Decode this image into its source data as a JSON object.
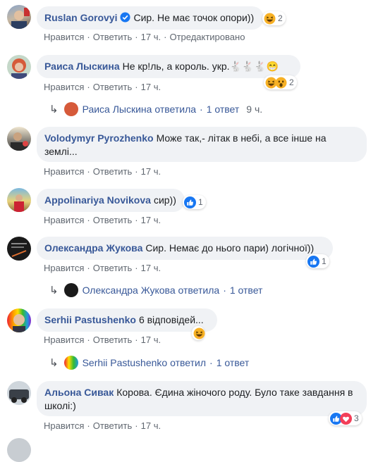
{
  "colors": {
    "link": "#385898",
    "bubble": "#f0f2f5",
    "meta": "#606770",
    "like": "#1877f2",
    "haha": "#f7b125",
    "love": "#f33e58"
  },
  "comments": [
    {
      "author": "Ruslan Gorovyi",
      "verified": true,
      "text": "Сир. Не має точок опори))",
      "actions": [
        "Нравится",
        "Ответить"
      ],
      "time": "17 ч.",
      "edited": "Отредактировано",
      "reactions": [
        "haha-emoji"
      ],
      "reaction_count": "2"
    },
    {
      "author": "Раиса Лыскина",
      "text": "Не кр!ль, а король. укр.🐇🐇🐇😁",
      "actions": [
        "Нравится",
        "Ответить"
      ],
      "time": "17 ч.",
      "reactions": [
        "haha-emoji",
        "wow-emoji"
      ],
      "reaction_count": "2",
      "reply": {
        "name": "Раиса Лыскина",
        "verb": "ответила",
        "count": "1 ответ",
        "time": "9 ч."
      }
    },
    {
      "author": "Volodymyr Pyrozhenko",
      "text": "Може так,- літак в небі, а все інше на землі...",
      "actions": [
        "Нравится",
        "Ответить"
      ],
      "time": "17 ч."
    },
    {
      "author": "Appolinariya Novikova",
      "text": "сир))",
      "actions": [
        "Нравится",
        "Ответить"
      ],
      "time": "17 ч.",
      "reactions": [
        "like-emoji"
      ],
      "reaction_count": "1"
    },
    {
      "author": "Олександра Жукова",
      "text": "Сир. Немає до нього пари) логічної))",
      "actions": [
        "Нравится",
        "Ответить"
      ],
      "time": "17 ч.",
      "reactions": [
        "like-emoji"
      ],
      "reaction_count": "1",
      "reply": {
        "name": "Олександра Жукова",
        "verb": "ответила",
        "count": "1 ответ"
      }
    },
    {
      "author": "Serhii Pastushenko",
      "text": "6 відповідей...",
      "actions": [
        "Нравится",
        "Ответить"
      ],
      "time": "17 ч.",
      "reactions": [
        "haha-emoji"
      ],
      "reaction_count": "",
      "reply": {
        "name": "Serhii Pastushenko",
        "verb": "ответил",
        "count": "1 ответ"
      }
    },
    {
      "author": "Альона Сивак",
      "text": "Корова. Єдина жіночого роду. Було таке завдання в школі:)",
      "actions": [
        "Нравится",
        "Ответить"
      ],
      "time": "17 ч.",
      "reactions": [
        "like-emoji",
        "love-emoji"
      ],
      "reaction_count": "3"
    }
  ]
}
